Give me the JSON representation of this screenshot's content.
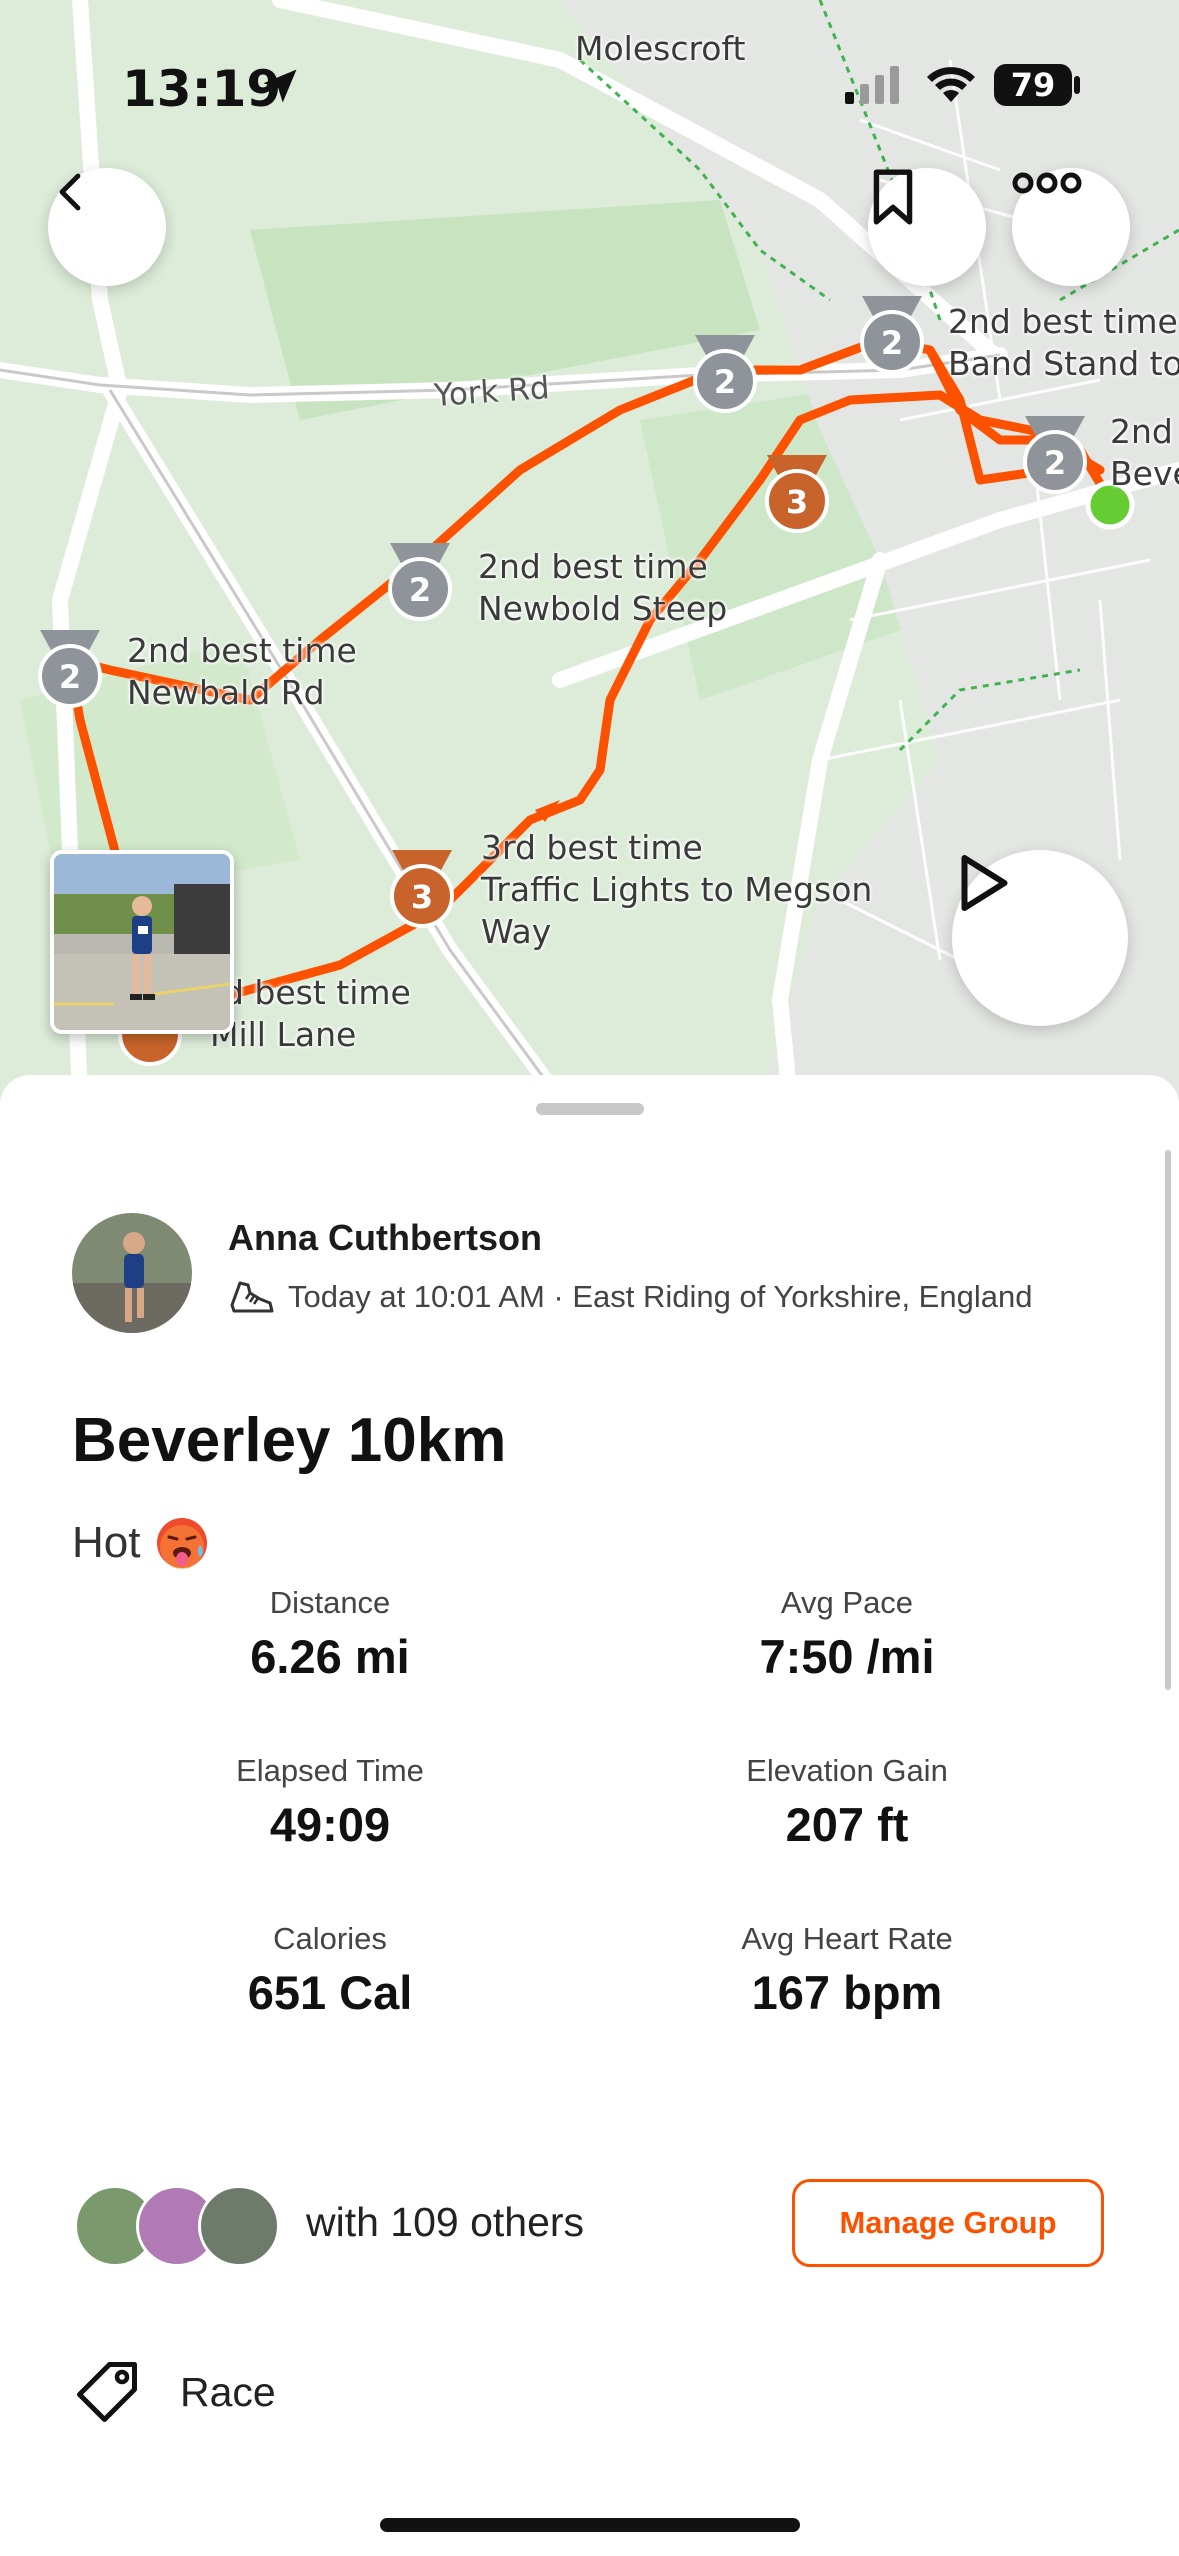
{
  "status_bar": {
    "time": "13:19",
    "battery": "79"
  },
  "map": {
    "place_label": "Molescroft",
    "road_label": "York Rd",
    "segments": [
      {
        "rank": "2",
        "line1": "2nd best time",
        "line2": "Newbald Rd"
      },
      {
        "rank": "2",
        "line1": "2nd best time",
        "line2": "Newbold Steep"
      },
      {
        "rank": "2",
        "line1": "2nd best time",
        "line2": "Band Stand to"
      },
      {
        "rank": "2",
        "line1": "2nd",
        "line2": "Beve"
      },
      {
        "rank": "3",
        "line1": "3rd best time",
        "line2": "Traffic Lights to Megson",
        "line3": "Way"
      },
      {
        "rank": "3",
        "line1": "rd best time",
        "line2": "Mill Lane"
      }
    ]
  },
  "activity": {
    "athlete": "Anna Cuthbertson",
    "meta": "Today at 10:01 AM · East Riding of Yorkshire, England",
    "title": "Beverley 10km",
    "description": "Hot",
    "stats": [
      {
        "label": "Distance",
        "value": "6.26 mi"
      },
      {
        "label": "Avg Pace",
        "value": "7:50 /mi"
      },
      {
        "label": "Elapsed Time",
        "value": "49:09"
      },
      {
        "label": "Elevation Gain",
        "value": "207 ft"
      },
      {
        "label": "Calories",
        "value": "651 Cal"
      },
      {
        "label": "Avg Heart Rate",
        "value": "167 bpm"
      }
    ],
    "group_text": "with 109 others",
    "manage_group_label": "Manage Group",
    "tag_label": "Race"
  },
  "colors": {
    "accent": "#fc5200",
    "route": "#fc5200",
    "silver_medal": "#8e9499",
    "bronze_medal": "#c8642b",
    "end_marker": "#66cc33"
  },
  "icons": [
    "back-arrow-icon",
    "bookmark-icon",
    "more-icon",
    "play-icon",
    "shoe-icon",
    "tag-icon",
    "location-arrow-icon",
    "wifi-icon",
    "signal-icon"
  ]
}
